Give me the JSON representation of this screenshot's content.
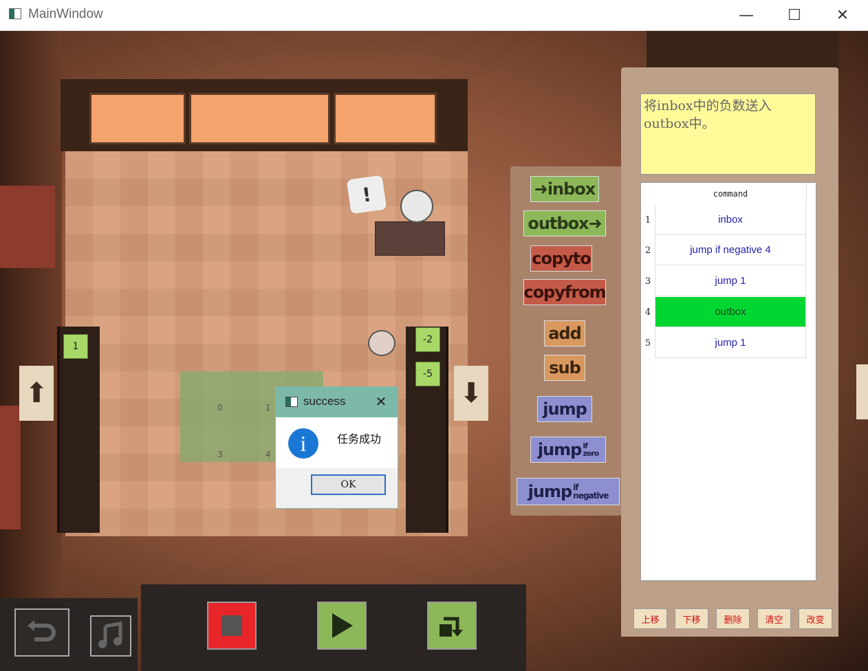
{
  "window": {
    "title": "MainWindow",
    "minimize_glyph": "—",
    "maximize_glyph": "☐",
    "close_glyph": "✕"
  },
  "scene": {
    "speech_bubble": "!",
    "inbox_items": [
      "1"
    ],
    "outbox_items": [
      "-2",
      "-5"
    ],
    "floor_grid_labels": [
      "0",
      "1",
      "3",
      "4"
    ]
  },
  "palette": {
    "inbox": "inbox",
    "outbox": "outbox",
    "copyto": "copyto",
    "copyfrom": "copyfrom",
    "add": "add",
    "sub": "sub",
    "jump": "jump",
    "jump_if_zero": "jump",
    "jump_if_negative": "jump"
  },
  "panel": {
    "description": "将inbox中的负数送入outbox中。",
    "table_header": "command",
    "rows": [
      {
        "num": "1",
        "command": "inbox"
      },
      {
        "num": "2",
        "command": "jump if negative 4"
      },
      {
        "num": "3",
        "command": "jump 1"
      },
      {
        "num": "4",
        "command": "outbox"
      },
      {
        "num": "5",
        "command": "jump 1"
      }
    ],
    "active_row": 4,
    "buttons": {
      "move_up": "上移",
      "move_down": "下移",
      "delete": "删除",
      "clear": "清空",
      "change": "改变"
    }
  },
  "dialog": {
    "title": "success",
    "message": "任务成功",
    "ok": "OK",
    "info_glyph": "i",
    "close_glyph": "✕"
  },
  "colors": {
    "active_row": "#00d632",
    "stop_button": "#e8262a",
    "command_text": "#2222aa"
  }
}
